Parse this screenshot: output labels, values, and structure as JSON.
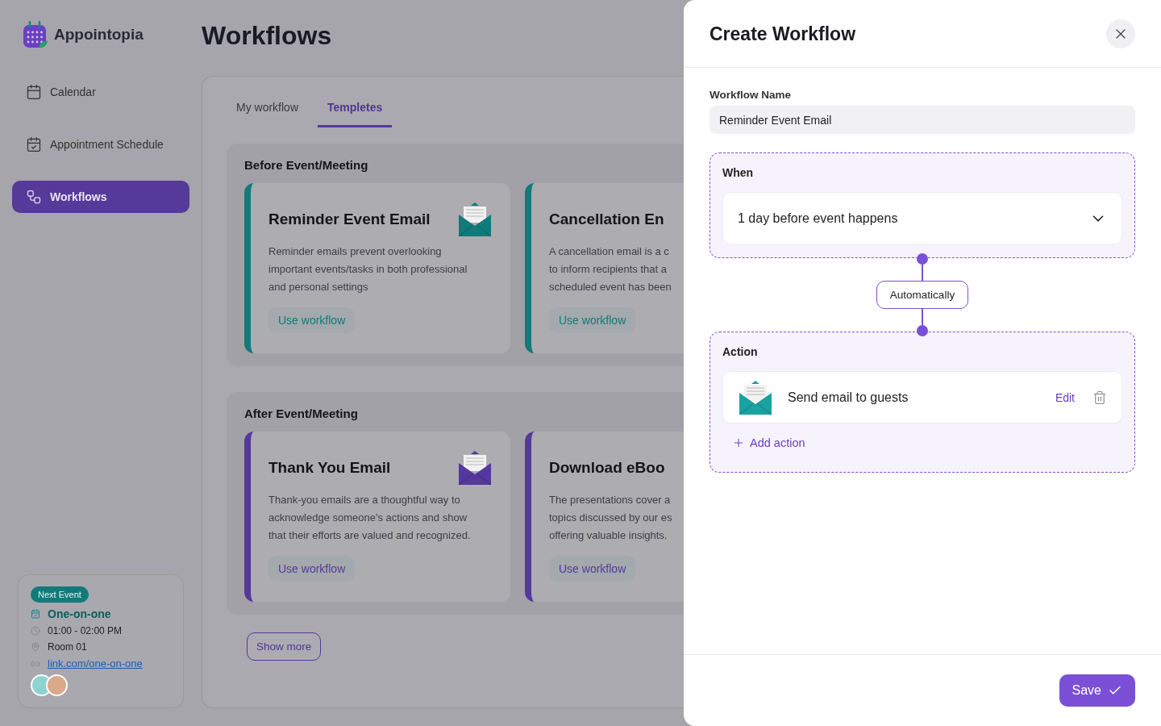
{
  "app": {
    "name": "Appointopia"
  },
  "sidebar": {
    "items": [
      {
        "label": "Calendar",
        "selected": false
      },
      {
        "label": "Appointment Schedule",
        "selected": false
      },
      {
        "label": "Workflows",
        "selected": true
      }
    ]
  },
  "next_event": {
    "badge": "Next Event",
    "title": "One-on-one",
    "time": "01:00 - 02:00 PM",
    "room": "Room 01",
    "link": "link.com/one-on-one"
  },
  "page_title": "Workflows",
  "tabs": [
    {
      "label": "My workflow",
      "selected": false
    },
    {
      "label": "Templetes",
      "selected": true
    }
  ],
  "sections": [
    {
      "title": "Before Event/Meeting",
      "cards": [
        {
          "title": "Reminder Event Email",
          "color": "#117a7a",
          "lines": [
            "Reminder emails prevent overlooking",
            "important events/tasks in both professional",
            "and personal settings"
          ],
          "button": "Use workflow"
        },
        {
          "title": "Cancellation En",
          "color": "#117a7a",
          "lines": [
            "A cancellation email is a c",
            "to inform recipients that a",
            "scheduled event has been"
          ],
          "button": "Use workflow"
        }
      ]
    },
    {
      "title": "After Event/Meeting",
      "cards": [
        {
          "title": "Thank You Email",
          "color": "#55389e",
          "lines": [
            "Thank-you emails are a thoughtful way to",
            "acknowledge someone's actions and show",
            "that their efforts are valued and recognized."
          ],
          "button": "Use workflow"
        },
        {
          "title": "Download eBoo",
          "color": "#55389e",
          "lines": [
            "The presentations cover a",
            "topics discussed by our es",
            "offering valuable insights."
          ],
          "button": "Use workflow"
        }
      ]
    }
  ],
  "show_more": "Show more",
  "drawer": {
    "title": "Create Workflow",
    "name_label": "Workflow Name",
    "name_value": "Reminder Event Email",
    "when": {
      "label": "When",
      "value": "1 day before event happens"
    },
    "connector": "Automatically",
    "action": {
      "label": "Action",
      "items": [
        {
          "label": "Send email to guests",
          "edit": "Edit"
        }
      ],
      "add": "Add action"
    },
    "save": "Save"
  }
}
